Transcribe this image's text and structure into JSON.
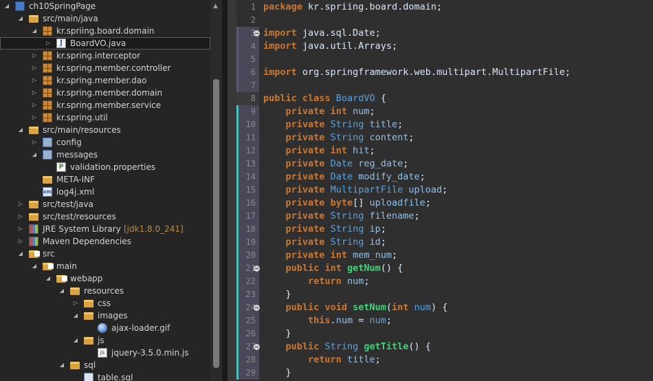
{
  "explorer": {
    "rows": [
      {
        "label": "ch10SpringPage",
        "depth": 0,
        "twisty": "open",
        "icon": "project-icon",
        "kind": "project"
      },
      {
        "label": "src/main/java",
        "depth": 1,
        "twisty": "open",
        "icon": "source-folder-icon",
        "kind": "srcfolder"
      },
      {
        "label": "kr.spriing.board.domain",
        "depth": 2,
        "twisty": "open",
        "icon": "package-icon",
        "kind": "package"
      },
      {
        "label": "BoardVO.java",
        "depth": 3,
        "twisty": "closed",
        "icon": "java-file-icon",
        "kind": "java",
        "selected": true
      },
      {
        "label": "kr.spring.interceptor",
        "depth": 2,
        "twisty": "closed",
        "icon": "package-icon",
        "kind": "package"
      },
      {
        "label": "kr.spring.member.controller",
        "depth": 2,
        "twisty": "closed",
        "icon": "package-icon",
        "kind": "package"
      },
      {
        "label": "kr.spring.member.dao",
        "depth": 2,
        "twisty": "closed",
        "icon": "package-icon",
        "kind": "package"
      },
      {
        "label": "kr.spring.member.domain",
        "depth": 2,
        "twisty": "closed",
        "icon": "package-icon",
        "kind": "package"
      },
      {
        "label": "kr.spring.member.service",
        "depth": 2,
        "twisty": "closed",
        "icon": "package-icon",
        "kind": "package"
      },
      {
        "label": "kr.spring.util",
        "depth": 2,
        "twisty": "closed",
        "icon": "package-icon",
        "kind": "package"
      },
      {
        "label": "src/main/resources",
        "depth": 1,
        "twisty": "open",
        "icon": "source-folder-icon",
        "kind": "srcfolder"
      },
      {
        "label": "config",
        "depth": 2,
        "twisty": "closed",
        "icon": "config-folder-icon",
        "kind": "config"
      },
      {
        "label": "messages",
        "depth": 2,
        "twisty": "open",
        "icon": "config-folder-icon",
        "kind": "config"
      },
      {
        "label": "validation.properties",
        "depth": 3,
        "twisty": "none",
        "icon": "properties-file-icon",
        "kind": "props"
      },
      {
        "label": "META-INF",
        "depth": 2,
        "twisty": "none",
        "icon": "folder-icon",
        "kind": "folder"
      },
      {
        "label": "log4j.xml",
        "depth": 2,
        "twisty": "none",
        "icon": "xml-file-icon",
        "kind": "xml"
      },
      {
        "label": "src/test/java",
        "depth": 1,
        "twisty": "closed",
        "icon": "source-folder-icon",
        "kind": "srcfolder"
      },
      {
        "label": "src/test/resources",
        "depth": 1,
        "twisty": "closed",
        "icon": "source-folder-icon",
        "kind": "srcfolder"
      },
      {
        "label": "JRE System Library",
        "decor": "[jdk1.8.0_241]",
        "depth": 1,
        "twisty": "closed",
        "icon": "library-icon",
        "kind": "library"
      },
      {
        "label": "Maven Dependencies",
        "depth": 1,
        "twisty": "closed",
        "icon": "library-icon",
        "kind": "library"
      },
      {
        "label": "src",
        "depth": 1,
        "twisty": "open",
        "icon": "folder-icon",
        "kind": "folder",
        "badge": true
      },
      {
        "label": "main",
        "depth": 2,
        "twisty": "open",
        "icon": "folder-icon",
        "kind": "folder",
        "badge": true
      },
      {
        "label": "webapp",
        "depth": 3,
        "twisty": "open",
        "icon": "folder-icon",
        "kind": "folder",
        "badge": true
      },
      {
        "label": "resources",
        "depth": 4,
        "twisty": "open",
        "icon": "folder-icon",
        "kind": "folder"
      },
      {
        "label": "css",
        "depth": 5,
        "twisty": "closed",
        "icon": "folder-icon",
        "kind": "folder"
      },
      {
        "label": "images",
        "depth": 5,
        "twisty": "open",
        "icon": "folder-icon",
        "kind": "folder"
      },
      {
        "label": "ajax-loader.gif",
        "depth": 6,
        "twisty": "none",
        "icon": "image-file-icon",
        "kind": "gif"
      },
      {
        "label": "js",
        "depth": 5,
        "twisty": "open",
        "icon": "folder-icon",
        "kind": "folder"
      },
      {
        "label": "jquery-3.5.0.min.js",
        "depth": 6,
        "twisty": "none",
        "icon": "js-file-icon",
        "kind": "js"
      },
      {
        "label": "sql",
        "depth": 4,
        "twisty": "open",
        "icon": "folder-icon",
        "kind": "folder"
      },
      {
        "label": "table.sql",
        "depth": 5,
        "twisty": "none",
        "icon": "sql-file-icon",
        "kind": "sql"
      }
    ]
  },
  "editor": {
    "lines": [
      {
        "n": "1",
        "tokens": [
          [
            "kw",
            "package"
          ],
          [
            "plain",
            " kr.spriing.board.domain;"
          ]
        ]
      },
      {
        "n": "2",
        "tokens": []
      },
      {
        "n": "3",
        "fold": true,
        "tokens": [
          [
            "kw",
            "import"
          ],
          [
            "plain",
            " java.sql.Date;"
          ]
        ]
      },
      {
        "n": "4",
        "tokens": [
          [
            "kw",
            "import"
          ],
          [
            "plain",
            " java.util.Arrays;"
          ]
        ]
      },
      {
        "n": "5",
        "tokens": []
      },
      {
        "n": "6",
        "tokens": [
          [
            "kw",
            "import"
          ],
          [
            "plain",
            " org.springframework.web.multipart.MultipartFile;"
          ]
        ]
      },
      {
        "n": "7",
        "tokens": []
      },
      {
        "n": "8",
        "tokens": [
          [
            "kw",
            "public"
          ],
          [
            "plain",
            " "
          ],
          [
            "kw",
            "class"
          ],
          [
            "plain",
            " "
          ],
          [
            "class",
            "BoardVO"
          ],
          [
            "plain",
            " {"
          ]
        ]
      },
      {
        "n": "9",
        "tokens": [
          [
            "plain",
            "    "
          ],
          [
            "kw",
            "private"
          ],
          [
            "plain",
            " "
          ],
          [
            "kw",
            "int"
          ],
          [
            "plain",
            " "
          ],
          [
            "field",
            "num"
          ],
          [
            "plain",
            ";"
          ]
        ]
      },
      {
        "n": "10",
        "tokens": [
          [
            "plain",
            "    "
          ],
          [
            "kw",
            "private"
          ],
          [
            "plain",
            " "
          ],
          [
            "type",
            "String"
          ],
          [
            "plain",
            " "
          ],
          [
            "field",
            "title"
          ],
          [
            "plain",
            ";"
          ]
        ]
      },
      {
        "n": "11",
        "tokens": [
          [
            "plain",
            "    "
          ],
          [
            "kw",
            "private"
          ],
          [
            "plain",
            " "
          ],
          [
            "type",
            "String"
          ],
          [
            "plain",
            " "
          ],
          [
            "field",
            "content"
          ],
          [
            "plain",
            ";"
          ]
        ]
      },
      {
        "n": "12",
        "tokens": [
          [
            "plain",
            "    "
          ],
          [
            "kw",
            "private"
          ],
          [
            "plain",
            " "
          ],
          [
            "kw",
            "int"
          ],
          [
            "plain",
            " "
          ],
          [
            "field",
            "hit"
          ],
          [
            "plain",
            ";"
          ]
        ]
      },
      {
        "n": "13",
        "tokens": [
          [
            "plain",
            "    "
          ],
          [
            "kw",
            "private"
          ],
          [
            "plain",
            " "
          ],
          [
            "type",
            "Date"
          ],
          [
            "plain",
            " "
          ],
          [
            "field",
            "reg_date"
          ],
          [
            "plain",
            ";"
          ]
        ]
      },
      {
        "n": "14",
        "tokens": [
          [
            "plain",
            "    "
          ],
          [
            "kw",
            "private"
          ],
          [
            "plain",
            " "
          ],
          [
            "type",
            "Date"
          ],
          [
            "plain",
            " "
          ],
          [
            "field",
            "modify_date"
          ],
          [
            "plain",
            ";"
          ]
        ]
      },
      {
        "n": "15",
        "tokens": [
          [
            "plain",
            "    "
          ],
          [
            "kw",
            "private"
          ],
          [
            "plain",
            " "
          ],
          [
            "type",
            "MultipartFile"
          ],
          [
            "plain",
            " "
          ],
          [
            "field",
            "upload"
          ],
          [
            "plain",
            ";"
          ]
        ]
      },
      {
        "n": "16",
        "tokens": [
          [
            "plain",
            "    "
          ],
          [
            "kw",
            "private"
          ],
          [
            "plain",
            " "
          ],
          [
            "kw",
            "byte"
          ],
          [
            "plain",
            "[] "
          ],
          [
            "field",
            "uploadfile"
          ],
          [
            "plain",
            ";"
          ]
        ]
      },
      {
        "n": "17",
        "tokens": [
          [
            "plain",
            "    "
          ],
          [
            "kw",
            "private"
          ],
          [
            "plain",
            " "
          ],
          [
            "type",
            "String"
          ],
          [
            "plain",
            " "
          ],
          [
            "field",
            "filename"
          ],
          [
            "plain",
            ";"
          ]
        ]
      },
      {
        "n": "18",
        "tokens": [
          [
            "plain",
            "    "
          ],
          [
            "kw",
            "private"
          ],
          [
            "plain",
            " "
          ],
          [
            "type",
            "String"
          ],
          [
            "plain",
            " "
          ],
          [
            "field",
            "ip"
          ],
          [
            "plain",
            ";"
          ]
        ]
      },
      {
        "n": "19",
        "tokens": [
          [
            "plain",
            "    "
          ],
          [
            "kw",
            "private"
          ],
          [
            "plain",
            " "
          ],
          [
            "type",
            "String"
          ],
          [
            "plain",
            " "
          ],
          [
            "field",
            "id"
          ],
          [
            "plain",
            ";"
          ]
        ]
      },
      {
        "n": "20",
        "tokens": [
          [
            "plain",
            "    "
          ],
          [
            "kw",
            "private"
          ],
          [
            "plain",
            " "
          ],
          [
            "kw",
            "int"
          ],
          [
            "plain",
            " "
          ],
          [
            "field",
            "mem_num"
          ],
          [
            "plain",
            ";"
          ]
        ]
      },
      {
        "n": "21",
        "fold": true,
        "tokens": [
          [
            "plain",
            "    "
          ],
          [
            "kw",
            "public"
          ],
          [
            "plain",
            " "
          ],
          [
            "kw",
            "int"
          ],
          [
            "plain",
            " "
          ],
          [
            "method",
            "getNum"
          ],
          [
            "plain",
            "() {"
          ]
        ]
      },
      {
        "n": "22",
        "tokens": [
          [
            "plain",
            "        "
          ],
          [
            "kw",
            "return"
          ],
          [
            "plain",
            " "
          ],
          [
            "field",
            "num"
          ],
          [
            "plain",
            ";"
          ]
        ]
      },
      {
        "n": "23",
        "tokens": [
          [
            "plain",
            "    }"
          ]
        ]
      },
      {
        "n": "24",
        "fold": true,
        "tokens": [
          [
            "plain",
            "    "
          ],
          [
            "kw",
            "public"
          ],
          [
            "plain",
            " "
          ],
          [
            "kw",
            "void"
          ],
          [
            "plain",
            " "
          ],
          [
            "method",
            "setNum"
          ],
          [
            "plain",
            "("
          ],
          [
            "kw",
            "int"
          ],
          [
            "plain",
            " "
          ],
          [
            "type",
            "num"
          ],
          [
            "plain",
            ") {"
          ]
        ]
      },
      {
        "n": "25",
        "tokens": [
          [
            "plain",
            "        "
          ],
          [
            "kw",
            "this"
          ],
          [
            "plain",
            "."
          ],
          [
            "field",
            "num"
          ],
          [
            "plain",
            " = "
          ],
          [
            "type",
            "num"
          ],
          [
            "plain",
            ";"
          ]
        ]
      },
      {
        "n": "26",
        "tokens": [
          [
            "plain",
            "    }"
          ]
        ]
      },
      {
        "n": "27",
        "fold": true,
        "tokens": [
          [
            "plain",
            "    "
          ],
          [
            "kw",
            "public"
          ],
          [
            "plain",
            " "
          ],
          [
            "type",
            "String"
          ],
          [
            "plain",
            " "
          ],
          [
            "method",
            "getTitle"
          ],
          [
            "plain",
            "() {"
          ]
        ]
      },
      {
        "n": "28",
        "tokens": [
          [
            "plain",
            "        "
          ],
          [
            "kw",
            "return"
          ],
          [
            "plain",
            " "
          ],
          [
            "field",
            "title"
          ],
          [
            "plain",
            ";"
          ]
        ]
      },
      {
        "n": "29",
        "tokens": [
          [
            "plain",
            "    }"
          ]
        ]
      }
    ]
  },
  "colors": {
    "keyword": "#cc7832",
    "type": "#5aa3e0",
    "field": "#8fc0ea",
    "method": "#3fd479",
    "plain": "#d9e8f7",
    "quickdiff_added": "#4fc1c1",
    "quickdiff_changed": "#5c5a6e"
  }
}
